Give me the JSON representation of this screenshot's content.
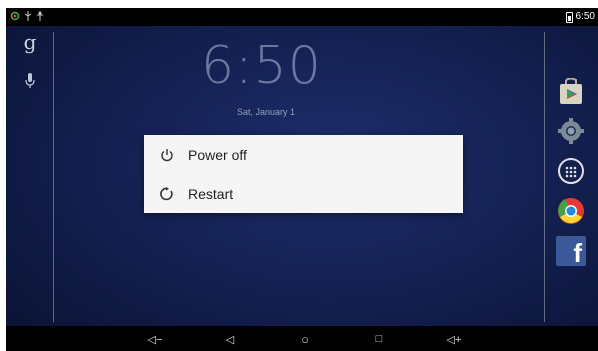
{
  "status_bar": {
    "time": "6:50",
    "icons": [
      "notification-icon",
      "usb-icon",
      "usb-debug-icon",
      "battery-icon"
    ],
    "left_icon_colors": [
      "#4caf50",
      "#cccccc",
      "#cccccc"
    ]
  },
  "lockscreen": {
    "clock": "6:50",
    "date": "Sat, January 1"
  },
  "left_rail": {
    "search_glyph": "g",
    "icons": [
      "google-search-icon",
      "microphone-icon"
    ]
  },
  "dock": {
    "apps": [
      "play-store-icon",
      "settings-icon",
      "app-drawer-icon",
      "chrome-icon",
      "facebook-icon"
    ],
    "facebook_letter": "f"
  },
  "power_dialog": {
    "options": [
      {
        "label": "Power off",
        "icon": "power-icon"
      },
      {
        "label": "Restart",
        "icon": "restart-icon"
      }
    ]
  },
  "nav_bar": {
    "buttons": [
      {
        "name": "volume-down-button",
        "label": "◁−"
      },
      {
        "name": "back-button",
        "label": "◁"
      },
      {
        "name": "home-button",
        "label": "○"
      },
      {
        "name": "recents-button",
        "label": "□"
      },
      {
        "name": "volume-up-button",
        "label": "◁+"
      }
    ]
  }
}
